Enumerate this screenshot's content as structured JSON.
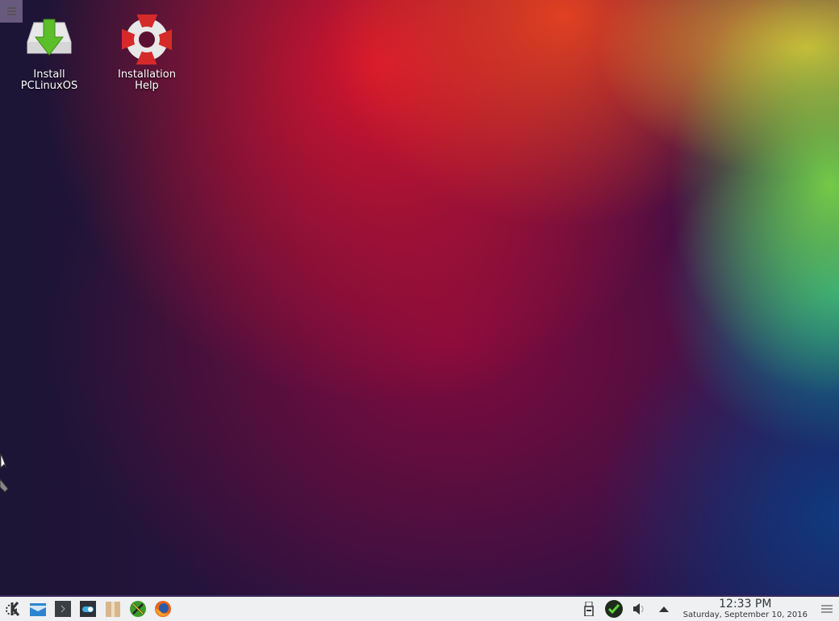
{
  "desktop": {
    "icons": [
      {
        "label_line1": "Install",
        "label_line2": "PCLinuxOS",
        "icon": "install-drive-icon"
      },
      {
        "label_line1": "Installation",
        "label_line2": "Help",
        "icon": "lifebuoy-icon"
      }
    ]
  },
  "taskbar": {
    "launchers": [
      "kde-menu-icon",
      "file-manager-icon",
      "terminal-icon",
      "settings-toggle-icon",
      "package-manager-icon",
      "control-center-icon",
      "firefox-icon"
    ],
    "tray": [
      "usb-device-icon",
      "update-check-icon",
      "volume-icon",
      "expand-tray-icon"
    ],
    "clock": {
      "time": "12:33 PM",
      "date": "Saturday, September 10, 2016"
    }
  }
}
